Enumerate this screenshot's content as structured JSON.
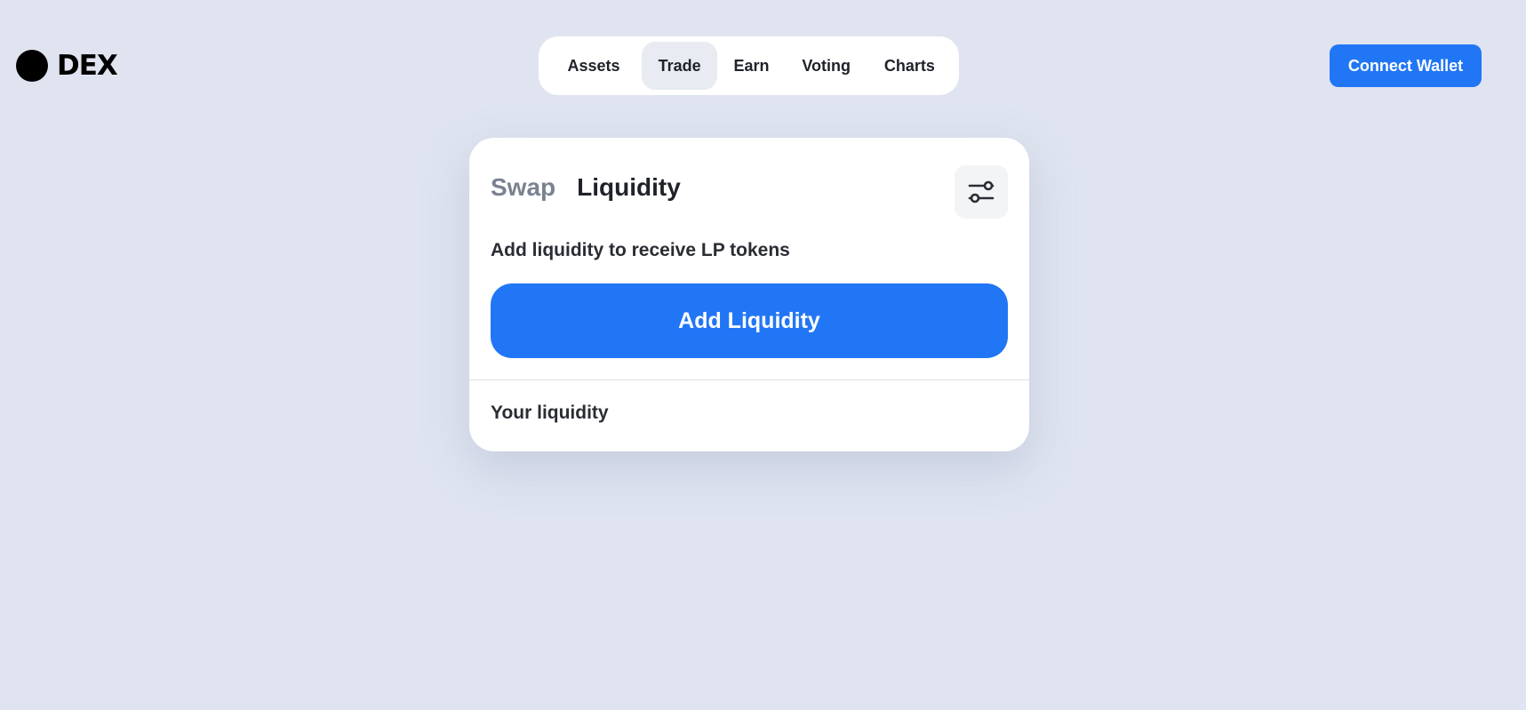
{
  "header": {
    "logo_text": "DEX",
    "logo_icon": "black-circle-icon",
    "nav": {
      "items": [
        {
          "label": "Assets"
        },
        {
          "label": "Trade",
          "active": true
        },
        {
          "label": "Earn"
        },
        {
          "label": "Voting"
        },
        {
          "label": "Charts"
        }
      ]
    },
    "connect_wallet_label": "Connect Wallet"
  },
  "card": {
    "tabs": [
      {
        "label": "Swap",
        "active": false
      },
      {
        "label": "Liquidity",
        "active": true
      }
    ],
    "settings_icon": "sliders-icon",
    "description": "Add liquidity to receive LP tokens",
    "add_liquidity_label": "Add Liquidity",
    "your_liquidity_label": "Your liquidity"
  },
  "colors": {
    "background": "#dfe4f0",
    "accent": "#2176f5",
    "card": "#ffffff",
    "text": "#1f2229",
    "muted_text": "#7a8290"
  }
}
